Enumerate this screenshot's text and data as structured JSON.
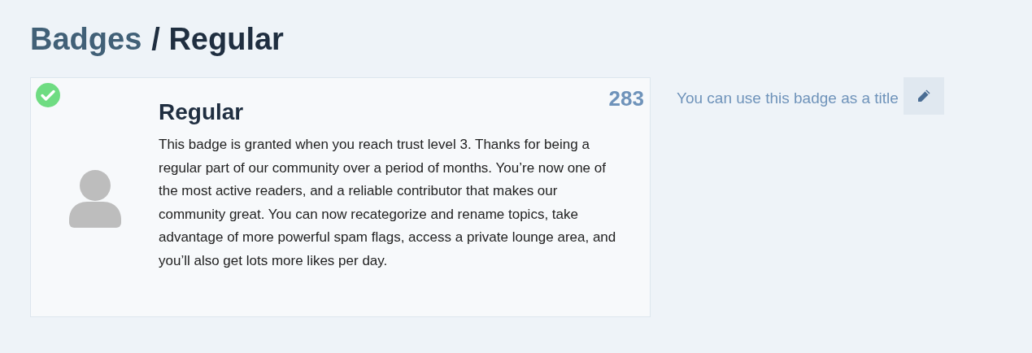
{
  "breadcrumb": {
    "parent": "Badges",
    "current": "/ Regular"
  },
  "badge": {
    "granted": true,
    "name": "Regular",
    "count": "283",
    "description": "This badge is granted when you reach trust level 3. Thanks for being a regular part of our community over a period of months. You’re now one of the most active readers, and a reliable contributor that makes our community great. You can now recategorize and rename topics, take advantage of more powerful spam flags, access a private lounge area, and you’ll also get lots more likes per day."
  },
  "title_hint": {
    "text": "You can use this badge as a title"
  }
}
